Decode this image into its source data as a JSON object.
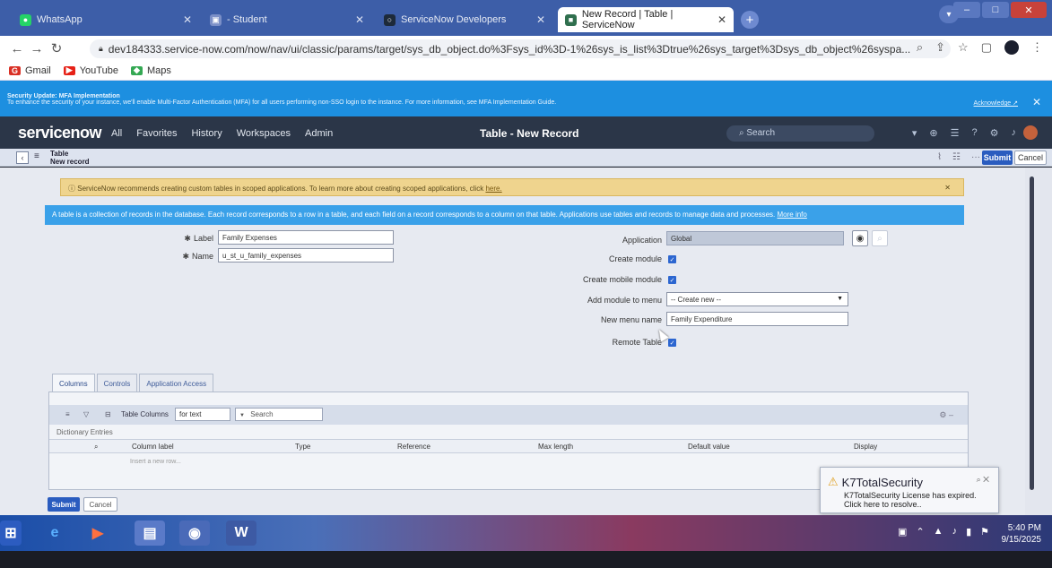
{
  "browser": {
    "tabs": [
      {
        "label": "WhatsApp",
        "active": false,
        "icon": "whatsapp-icon"
      },
      {
        "label": "- Student",
        "active": false,
        "icon": "student-icon"
      },
      {
        "label": "ServiceNow Developers",
        "active": false,
        "icon": "servicenow-icon"
      },
      {
        "label": "New Record | Table | ServiceNow",
        "active": true,
        "icon": "servicenow-icon"
      }
    ],
    "url": "dev184333.service-now.com/now/nav/ui/classic/params/target/sys_db_object.do%3Fsys_id%3D-1%26sys_is_list%3Dtrue%26sys_target%3Dsys_db_object%26syspa...",
    "bookmarks": [
      {
        "label": "Gmail",
        "icon": "gmail-icon",
        "color": "#d93025"
      },
      {
        "label": "YouTube",
        "icon": "youtube-icon",
        "color": "#e62117"
      },
      {
        "label": "Maps",
        "icon": "maps-icon",
        "color": "#34a853"
      }
    ]
  },
  "mfa_banner": {
    "title": "Security Update: MFA Implementation",
    "text": "To enhance the security of your instance, we'll enable Multi-Factor Authentication (MFA) for all users performing non-SSO login to the instance. For more information, see MFA Implementation Guide.",
    "acknowledge": "Acknowledge ↗"
  },
  "sn_header": {
    "logo": "servicenow",
    "nav": [
      "All",
      "Favorites",
      "History",
      "Workspaces",
      "Admin"
    ],
    "title": "Table - New Record",
    "search_placeholder": "Search"
  },
  "form_header": {
    "line1": "Table",
    "line2": "New record",
    "submit": "Submit",
    "cancel": "Cancel"
  },
  "warning": {
    "text": "ServiceNow recommends creating custom tables in scoped applications. To learn more about creating scoped applications, click",
    "link": "here."
  },
  "info": {
    "text": "A table is a collection of records in the database. Each record corresponds to a row in a table, and each field on a record corresponds to a column on that table. Applications use tables and records to manage data and processes.",
    "link": "More info"
  },
  "form": {
    "label_label": "Label",
    "label_value": "Family Expenses",
    "name_label": "Name",
    "name_value": "u_st_u_family_expenses",
    "application_label": "Application",
    "application_value": "Global",
    "create_module_label": "Create module",
    "create_mobile_module_label": "Create mobile module",
    "add_module_label": "Add module to menu",
    "add_module_value": "-- Create new --",
    "new_menu_name_label": "New menu name",
    "new_menu_name_value": "Family Expenditure",
    "remote_table_label": "Remote Table"
  },
  "related": {
    "tabs": [
      "Columns",
      "Controls",
      "Application Access"
    ],
    "list_title": "Table Columns",
    "filter_value": "for text",
    "search_placeholder": "Search",
    "dictionary": "Dictionary Entries",
    "columns": [
      "Column label",
      "Type",
      "Reference",
      "Max length",
      "Default value",
      "Display"
    ],
    "insert_row": "Insert a new row..."
  },
  "bottom_buttons": {
    "submit": "Submit",
    "cancel": "Cancel"
  },
  "toast": {
    "title": "K7TotalSecurity",
    "line1": "K7TotalSecurity License has expired.",
    "line2": "Click here to resolve.."
  },
  "taskbar": {
    "time": "5:40 PM",
    "date": "9/15/2025"
  },
  "colors": {
    "tabstrip": "#3d5ea8",
    "mfa_banner": "#1d8fe0",
    "sn_header": "#2b3648",
    "submit": "#2a5cbf",
    "warning": "#efd48e",
    "info": "#3aa1e9"
  }
}
